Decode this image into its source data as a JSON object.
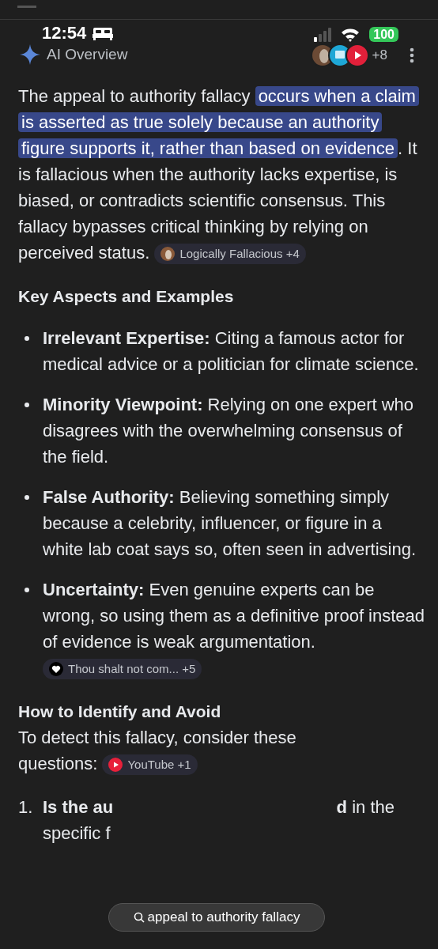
{
  "status_bar": {
    "time": "12:54",
    "battery": "100"
  },
  "header": {
    "title": "AI Overview",
    "sources_more": "+8"
  },
  "intro": {
    "before": "The appeal to authority fallacy ",
    "highlight": "occurs when a claim is asserted as true solely because an authority figure supports it, rather than based on evidence",
    "after": ". It is fallacious when the authority lacks expertise, is biased, or contradicts scientific consensus. This fallacy bypasses critical thinking by relying on perceived status.",
    "chip": {
      "label": "Logically Fallacious +4",
      "kind": "photo"
    }
  },
  "section_1": {
    "heading": "Key Aspects and Examples",
    "bullets": [
      {
        "text": "**Irrelevant Expertise:** Citing a famous actor for medical advice or a politician for climate science."
      },
      {
        "text": "**Minority Viewpoint:** Relying on one expert who disagrees with the overwhelming consensus of the field."
      },
      {
        "text": "**False Authority:** Believing something simply because a celebrity, influencer, or figure in a white lab coat says so, often seen in advertising."
      },
      {
        "text": "**Uncertainty:** Even genuine experts can be wrong, so using them as a definitive proof instead of evidence is weak argumentation.",
        "chip": {
          "label": "Thou shalt not com... +5",
          "kind": "heart"
        }
      }
    ]
  },
  "section_2": {
    "heading": "How to Identify and Avoid",
    "text": "To detect this fallacy, consider these questions:",
    "chip": {
      "label": "YouTube +1",
      "kind": "play"
    },
    "items": [
      {
        "number": "1.",
        "line_1_start": "Is the au",
        "line_1_end": "**d** in the",
        "line_2": "specific f"
      }
    ]
  },
  "search_pill": {
    "query": "appeal to authority fallacy"
  }
}
